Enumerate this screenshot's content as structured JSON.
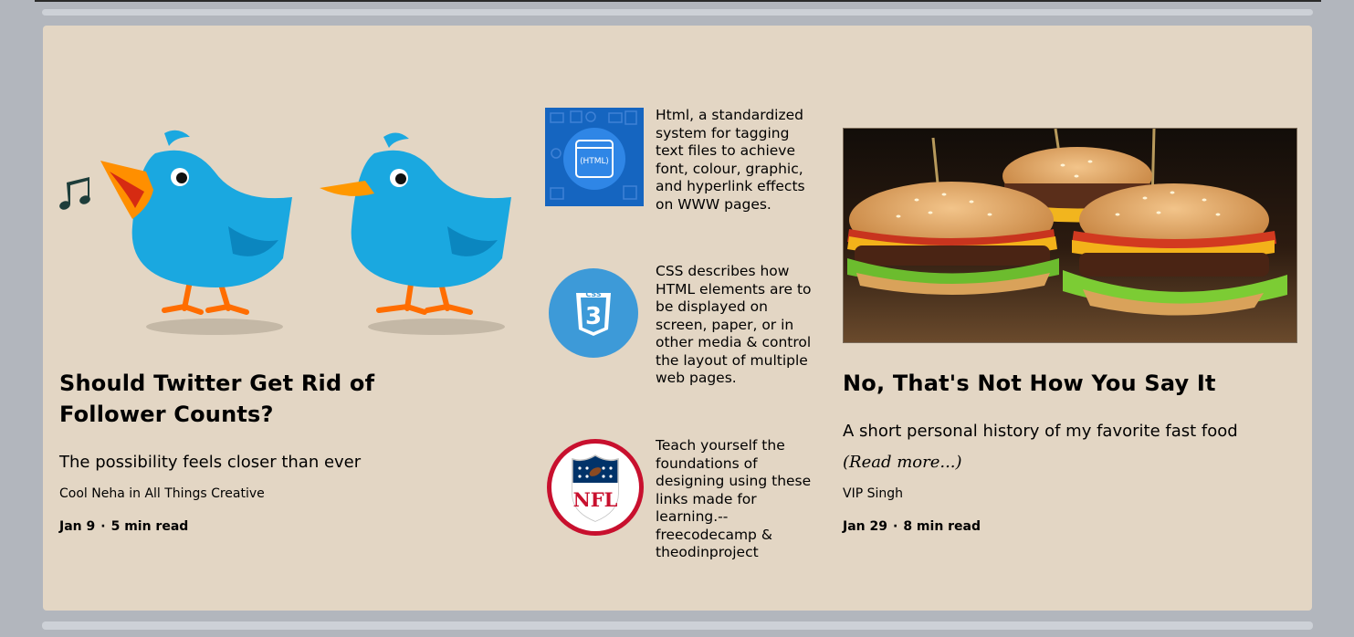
{
  "articles": [
    {
      "title": "Should Twitter Get Rid of Follower Counts?",
      "subtitle": "The possibility feels closer than ever",
      "author": "Cool Neha in All Things Creative",
      "date": "Jan 9",
      "read_time": "5 min read"
    },
    {
      "title": "No, That's Not How You Say It",
      "subtitle": "A short personal history of my favorite fast food",
      "read_more": "(Read more...)",
      "author": "VIP Singh",
      "date": "Jan 29",
      "read_time": "8 min read"
    }
  ],
  "mini_items": [
    {
      "icon": "html-icon",
      "icon_text": "⟨HTML⟩",
      "text": "Html, a standardized system for tagging text files to achieve font, colour, graphic, and hyperlink effects on WWW pages."
    },
    {
      "icon": "css-icon",
      "icon_text": "CSS",
      "icon_number": "3",
      "text": "CSS describes how HTML elements are to be displayed on screen, paper, or in other media & control the layout of multiple web pages."
    },
    {
      "icon": "nfl-icon",
      "icon_text": "NFL",
      "text": "Teach yourself the foundations of designing using these links made for learning.--freecodecamp & theodinproject"
    }
  ],
  "meta_separator": "·",
  "colors": {
    "page_bg": "#b2b6bd",
    "card_bg": "#e3d6c4",
    "bird_blue": "#1aa8e0",
    "html_blue": "#1565c0",
    "css_blue": "#3d9ad8",
    "nfl_red": "#c8102e",
    "nfl_navy": "#013369"
  }
}
